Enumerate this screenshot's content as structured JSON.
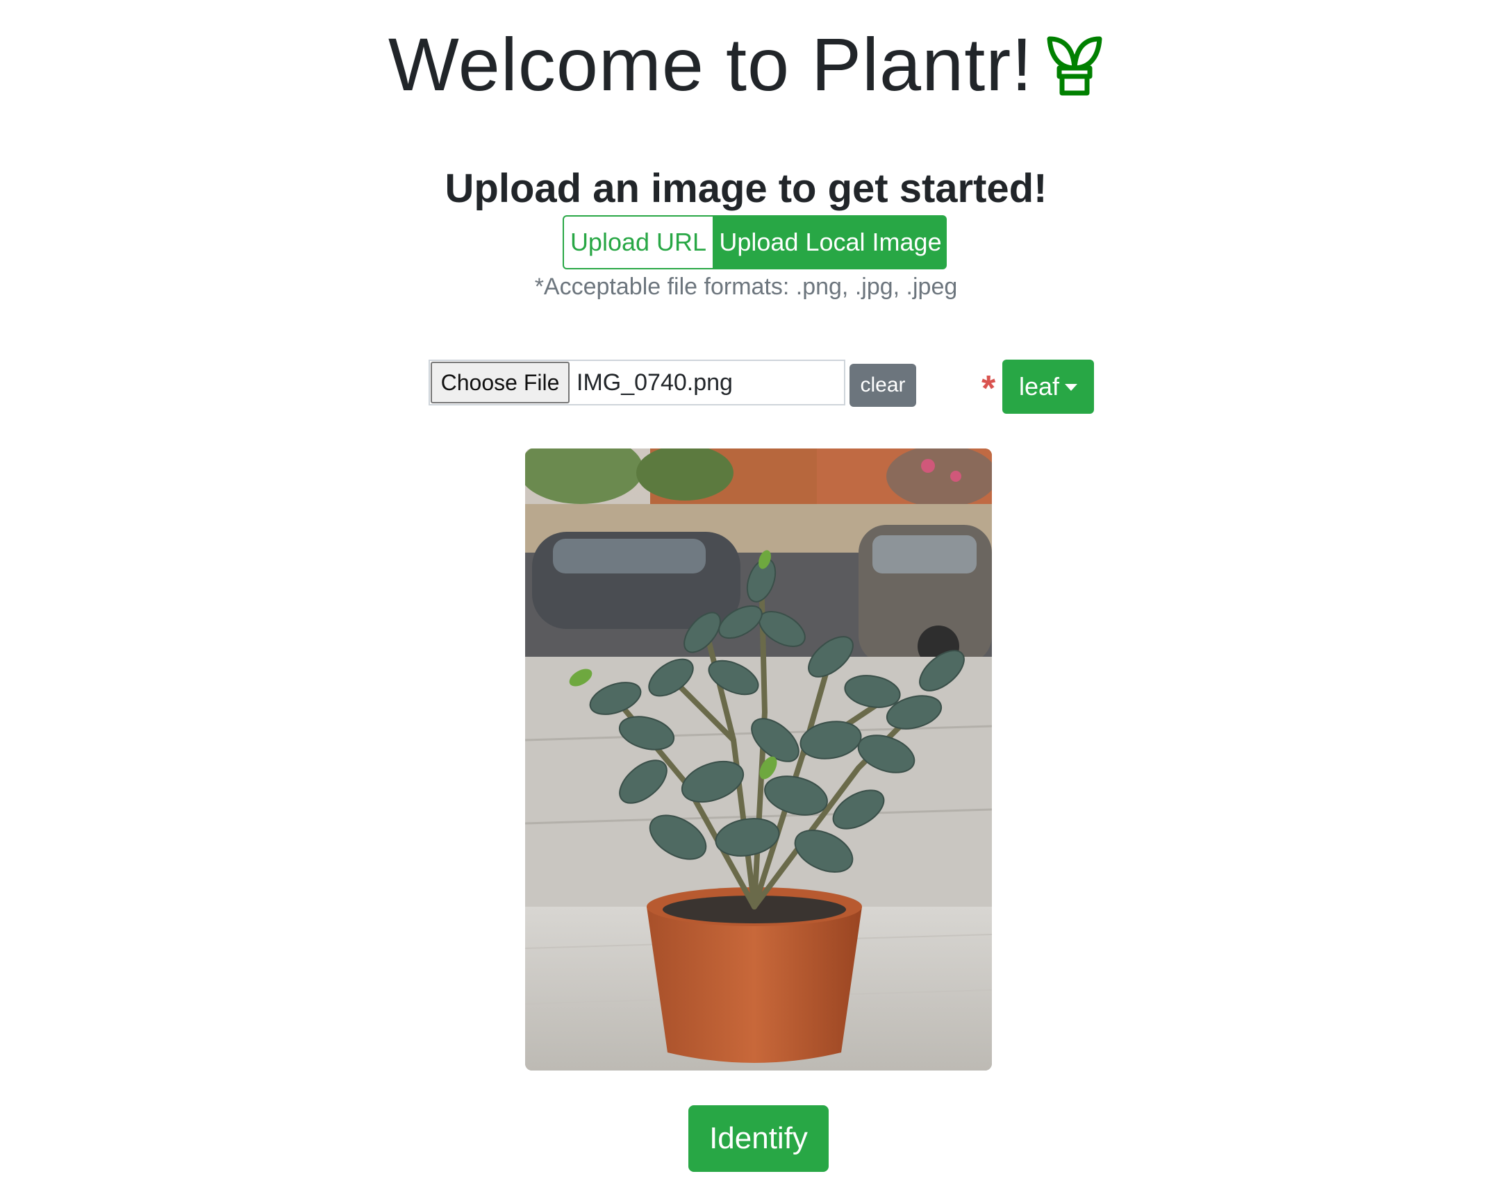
{
  "header": {
    "title": "Welcome to Plantr!",
    "icon": "potted-sprout-icon",
    "icon_color": "#008000"
  },
  "upload": {
    "subtitle": "Upload an image to get started!",
    "url_button": "Upload URL",
    "local_button": "Upload Local Image",
    "active": "Upload Local Image",
    "formats_note": "*Acceptable file formats: .png, .jpg, .jpeg"
  },
  "file_input": {
    "choose_label": "Choose File",
    "file_name": "IMG_0740.png"
  },
  "controls": {
    "clear_label": "clear",
    "required_mark": "*",
    "organ_selected": "leaf"
  },
  "preview": {
    "image": "potted-jade-plant-photo"
  },
  "actions": {
    "identify_label": "Identify"
  },
  "colors": {
    "accent": "#28a745",
    "secondary": "#6c757d",
    "required": "#d9534f",
    "text": "#212529"
  }
}
